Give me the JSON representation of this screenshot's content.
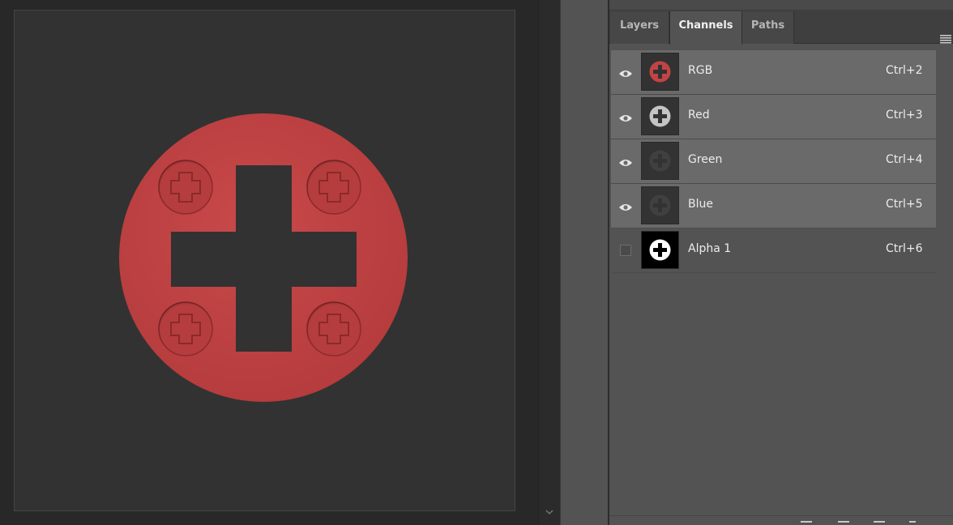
{
  "tabs": [
    {
      "label": "Layers",
      "active": false
    },
    {
      "label": "Channels",
      "active": true
    },
    {
      "label": "Paths",
      "active": false
    }
  ],
  "channels": [
    {
      "name": "RGB",
      "shortcut": "Ctrl+2",
      "visible": true,
      "thumbnail": "composite-red"
    },
    {
      "name": "Red",
      "shortcut": "Ctrl+3",
      "visible": true,
      "thumbnail": "light-gray"
    },
    {
      "name": "Green",
      "shortcut": "Ctrl+4",
      "visible": true,
      "thumbnail": "dark-gray"
    },
    {
      "name": "Blue",
      "shortcut": "Ctrl+5",
      "visible": true,
      "thumbnail": "dark-gray"
    },
    {
      "name": "Alpha 1",
      "shortcut": "Ctrl+6",
      "visible": false,
      "thumbnail": "black-white"
    }
  ],
  "colors": {
    "artwork_red": "#c34344",
    "canvas_bg": "#323232",
    "panel_bg": "#535353",
    "row_highlight": "#6a6a6a"
  },
  "icons": [
    "eye-icon",
    "panel-menu-icon",
    "scroll-down-arrow-icon"
  ]
}
